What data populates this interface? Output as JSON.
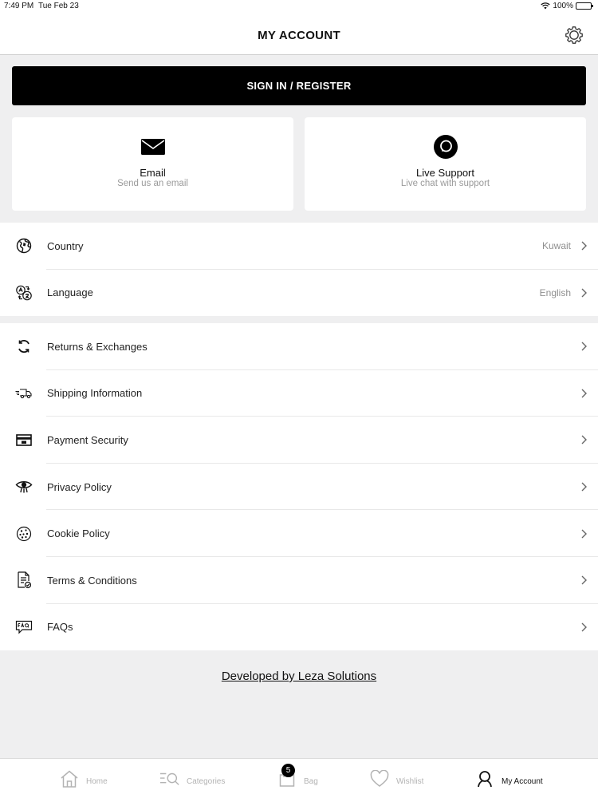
{
  "status_bar": {
    "time": "7:49 PM",
    "date": "Tue Feb 23",
    "battery": "100%"
  },
  "header": {
    "title": "MY ACCOUNT"
  },
  "signin": {
    "label": "SIGN IN / REGISTER"
  },
  "cards": [
    {
      "title": "Email",
      "subtitle": "Send us an email",
      "icon": "envelope-icon"
    },
    {
      "title": "Live Support",
      "subtitle": "Live chat with support",
      "icon": "chat-icon"
    }
  ],
  "settings_group": [
    {
      "label": "Country",
      "value": "Kuwait",
      "icon": "globe-icon"
    },
    {
      "label": "Language",
      "value": "English",
      "icon": "language-icon"
    }
  ],
  "info_group": [
    {
      "label": "Returns & Exchanges",
      "icon": "refresh-icon"
    },
    {
      "label": "Shipping Information",
      "icon": "truck-icon"
    },
    {
      "label": "Payment Security",
      "icon": "card-icon"
    },
    {
      "label": "Privacy Policy",
      "icon": "eye-icon"
    },
    {
      "label": "Cookie Policy",
      "icon": "cookie-icon"
    },
    {
      "label": "Terms & Conditions",
      "icon": "document-icon"
    },
    {
      "label": "FAQs",
      "icon": "faq-icon"
    }
  ],
  "footer": {
    "developer_link": "Developed by Leza Solutions"
  },
  "tab_bar": {
    "items": [
      {
        "label": "Home",
        "icon": "home-icon"
      },
      {
        "label": "Categories",
        "icon": "categories-icon"
      },
      {
        "label": "Bag",
        "icon": "bag-icon",
        "badge": "5"
      },
      {
        "label": "Wishlist",
        "icon": "heart-icon"
      },
      {
        "label": "My Account",
        "icon": "user-icon"
      }
    ],
    "active": "My Account"
  },
  "colors": {
    "primary": "#000000",
    "background": "#efeff0",
    "muted_text": "#9a9a9a"
  }
}
